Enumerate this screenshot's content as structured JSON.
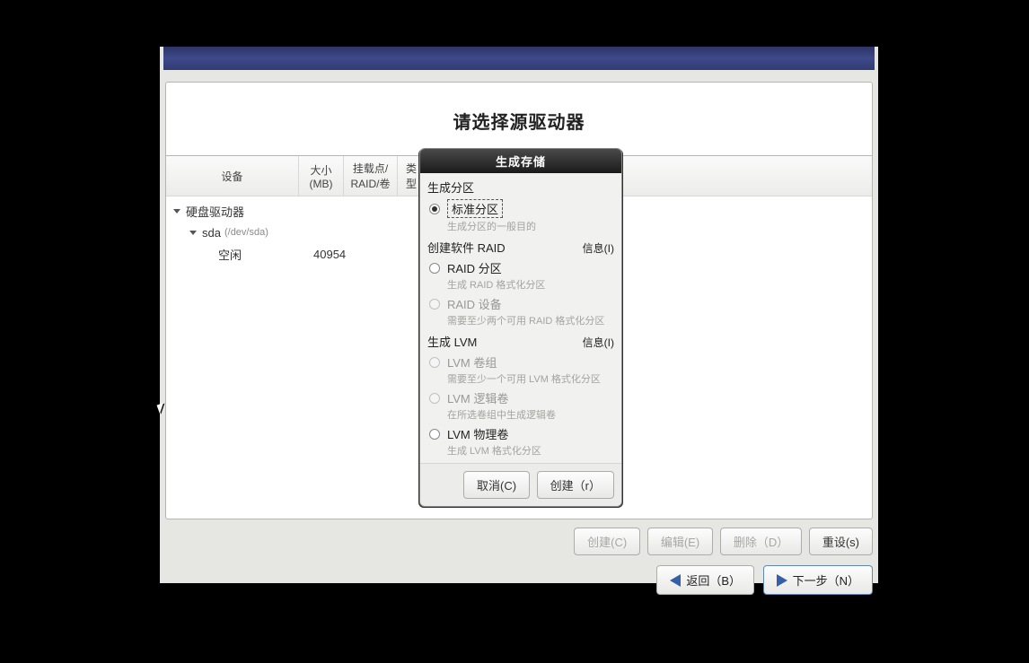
{
  "main": {
    "title": "请选择源驱动器",
    "columns": {
      "device": "设备",
      "size": "大小\n(MB)",
      "mount": "挂载点/\nRAID/卷",
      "type": "类型"
    },
    "tree": {
      "root": "硬盘驱动器",
      "disk": "sda",
      "disk_path": "(/dev/sda)",
      "free_label": "空闲",
      "free_size": "40954"
    },
    "buttons": {
      "create": "创建(C)",
      "edit": "编辑(E)",
      "delete": "删除（D）",
      "reset": "重设(s)"
    },
    "nav": {
      "back": "返回（B）",
      "next": "下一步（N）"
    }
  },
  "dialog": {
    "title": "生成存储",
    "section_partition": "生成分区",
    "opt_standard": "标准分区",
    "opt_standard_desc": "生成分区的一般目的",
    "section_raid": "创建软件 RAID",
    "info": "信息(I)",
    "opt_raid_part": "RAID 分区",
    "opt_raid_part_desc": "生成 RAID 格式化分区",
    "opt_raid_dev": "RAID 设备",
    "opt_raid_dev_desc": "需要至少两个可用 RAID 格式化分区",
    "section_lvm": "生成 LVM",
    "opt_lvm_group": "LVM 卷组",
    "opt_lvm_group_desc": "需要至少一个可用 LVM 格式化分区",
    "opt_lvm_logical": "LVM 逻辑卷",
    "opt_lvm_logical_desc": "在所选卷组中生成逻辑卷",
    "opt_lvm_physical": "LVM 物理卷",
    "opt_lvm_physical_desc": "生成 LVM 格式化分区",
    "btn_cancel": "取消(C)",
    "btn_create": "创建（r）"
  }
}
